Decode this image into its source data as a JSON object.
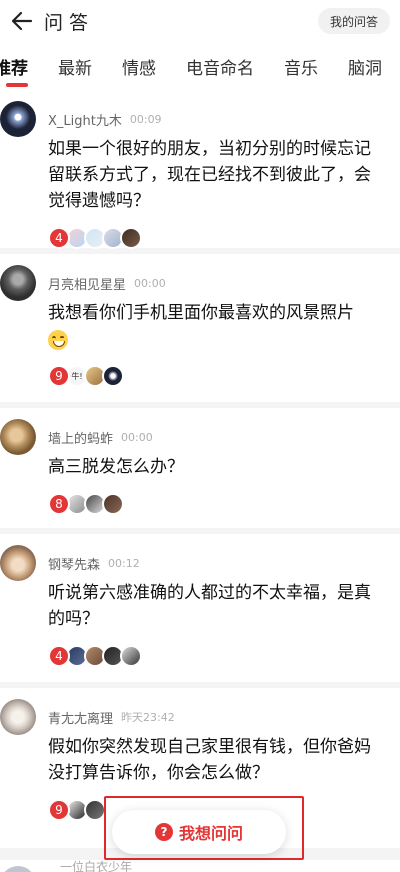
{
  "header": {
    "title": "问 答",
    "my_qa_label": "我的问答",
    "back_icon": "back-arrow-icon"
  },
  "tabs": [
    "推荐",
    "最新",
    "情感",
    "电音命名",
    "音乐",
    "脑洞"
  ],
  "active_tab": "推荐",
  "questions": [
    {
      "user": "X_Light九木",
      "time": "00:09",
      "text": "如果一个很好的朋友，当初分别的时候忘记留联系方式了，现在已经找不到彼此了，会觉得遗憾吗？",
      "answer_count": "4",
      "avatar_color": "#1d2337"
    },
    {
      "user": "月亮相见星星",
      "time": "00:00",
      "text": "我想看你们手机里面你最喜欢的风景照片",
      "emoji": "grinning-face-emoji",
      "answer_count": "9",
      "avatar_color": "#6d6d6d",
      "mini_label": "牛!"
    },
    {
      "user": "墙上的蚂蚱",
      "time": "00:00",
      "text": "高三脱发怎么办？",
      "answer_count": "8",
      "avatar_color": "#b08a58"
    },
    {
      "user": "钢琴先森",
      "time": "00:12",
      "text": "听说第六感准确的人都过的不太幸福，是真的吗？",
      "answer_count": "4",
      "avatar_color": "#c9a27d"
    },
    {
      "user": "青尢尢离理",
      "time": "昨天23:42",
      "text": "假如你突然发现自己家里很有钱，但你爸妈没打算告诉你，你会怎么做？",
      "answer_count": "9",
      "avatar_color": "#d8d0c8"
    }
  ],
  "next_preview_user": "一位白衣少年",
  "ask_button": {
    "label": "我想问问",
    "icon": "question-bubble-icon",
    "icon_glyph": "?"
  },
  "colors": {
    "accent": "#e33636",
    "highlight_box": "#e02a2a",
    "background": "#f4f4f4"
  }
}
